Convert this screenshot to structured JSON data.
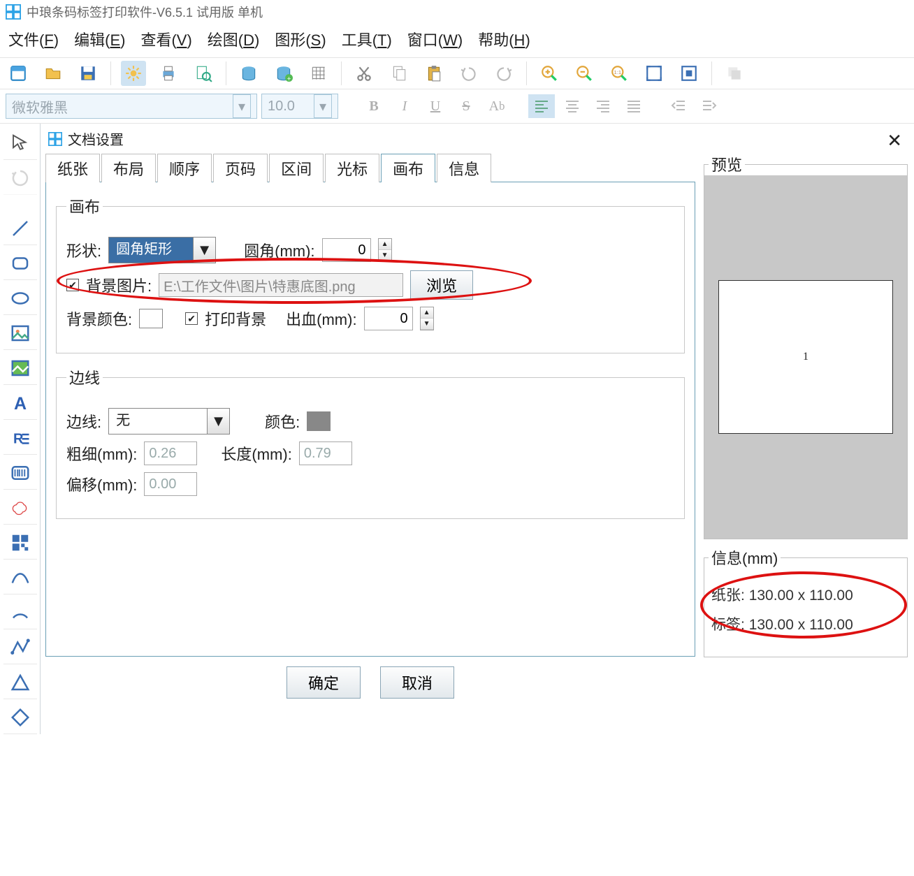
{
  "title": "中琅条码标签打印软件-V6.5.1 试用版 单机",
  "menu": {
    "file": "文件(F)",
    "edit": "编辑(E)",
    "view": "查看(V)",
    "draw": "绘图(D)",
    "shape": "图形(S)",
    "tool": "工具(T)",
    "window": "窗口(W)",
    "help": "帮助(H)"
  },
  "fontbar": {
    "font_name": "微软雅黑",
    "font_size": "10.0"
  },
  "dialog": {
    "title": "文档设置",
    "tabs": [
      "纸张",
      "布局",
      "顺序",
      "页码",
      "区间",
      "光标",
      "画布",
      "信息"
    ],
    "active_tab_index": 6,
    "canvas": {
      "legend": "画布",
      "shape_label": "形状:",
      "shape_value": "圆角矩形",
      "corner_label": "圆角(mm):",
      "corner_value": "0",
      "bgimg_check_label": "背景图片:",
      "bgimg_checked": true,
      "bgimg_path": "E:\\工作文件\\图片\\特惠底图.png",
      "browse_btn": "浏览",
      "bgcolor_label": "背景颜色:",
      "printbg_label": "打印背景",
      "printbg_checked": true,
      "bleed_label": "出血(mm):",
      "bleed_value": "0"
    },
    "border": {
      "legend": "边线",
      "border_label": "边线:",
      "border_value": "无",
      "color_label": "颜色:",
      "thick_label": "粗细(mm):",
      "thick_value": "0.26",
      "length_label": "长度(mm):",
      "length_value": "0.79",
      "offset_label": "偏移(mm):",
      "offset_value": "0.00"
    },
    "preview_legend": "预览",
    "preview_page_num": "1",
    "info": {
      "legend": "信息(mm)",
      "paper_label": "纸张:",
      "paper_value": "130.00 x 110.00",
      "label_label": "标签:",
      "label_value": "130.00 x 110.00"
    },
    "ok_btn": "确定",
    "cancel_btn": "取消"
  }
}
